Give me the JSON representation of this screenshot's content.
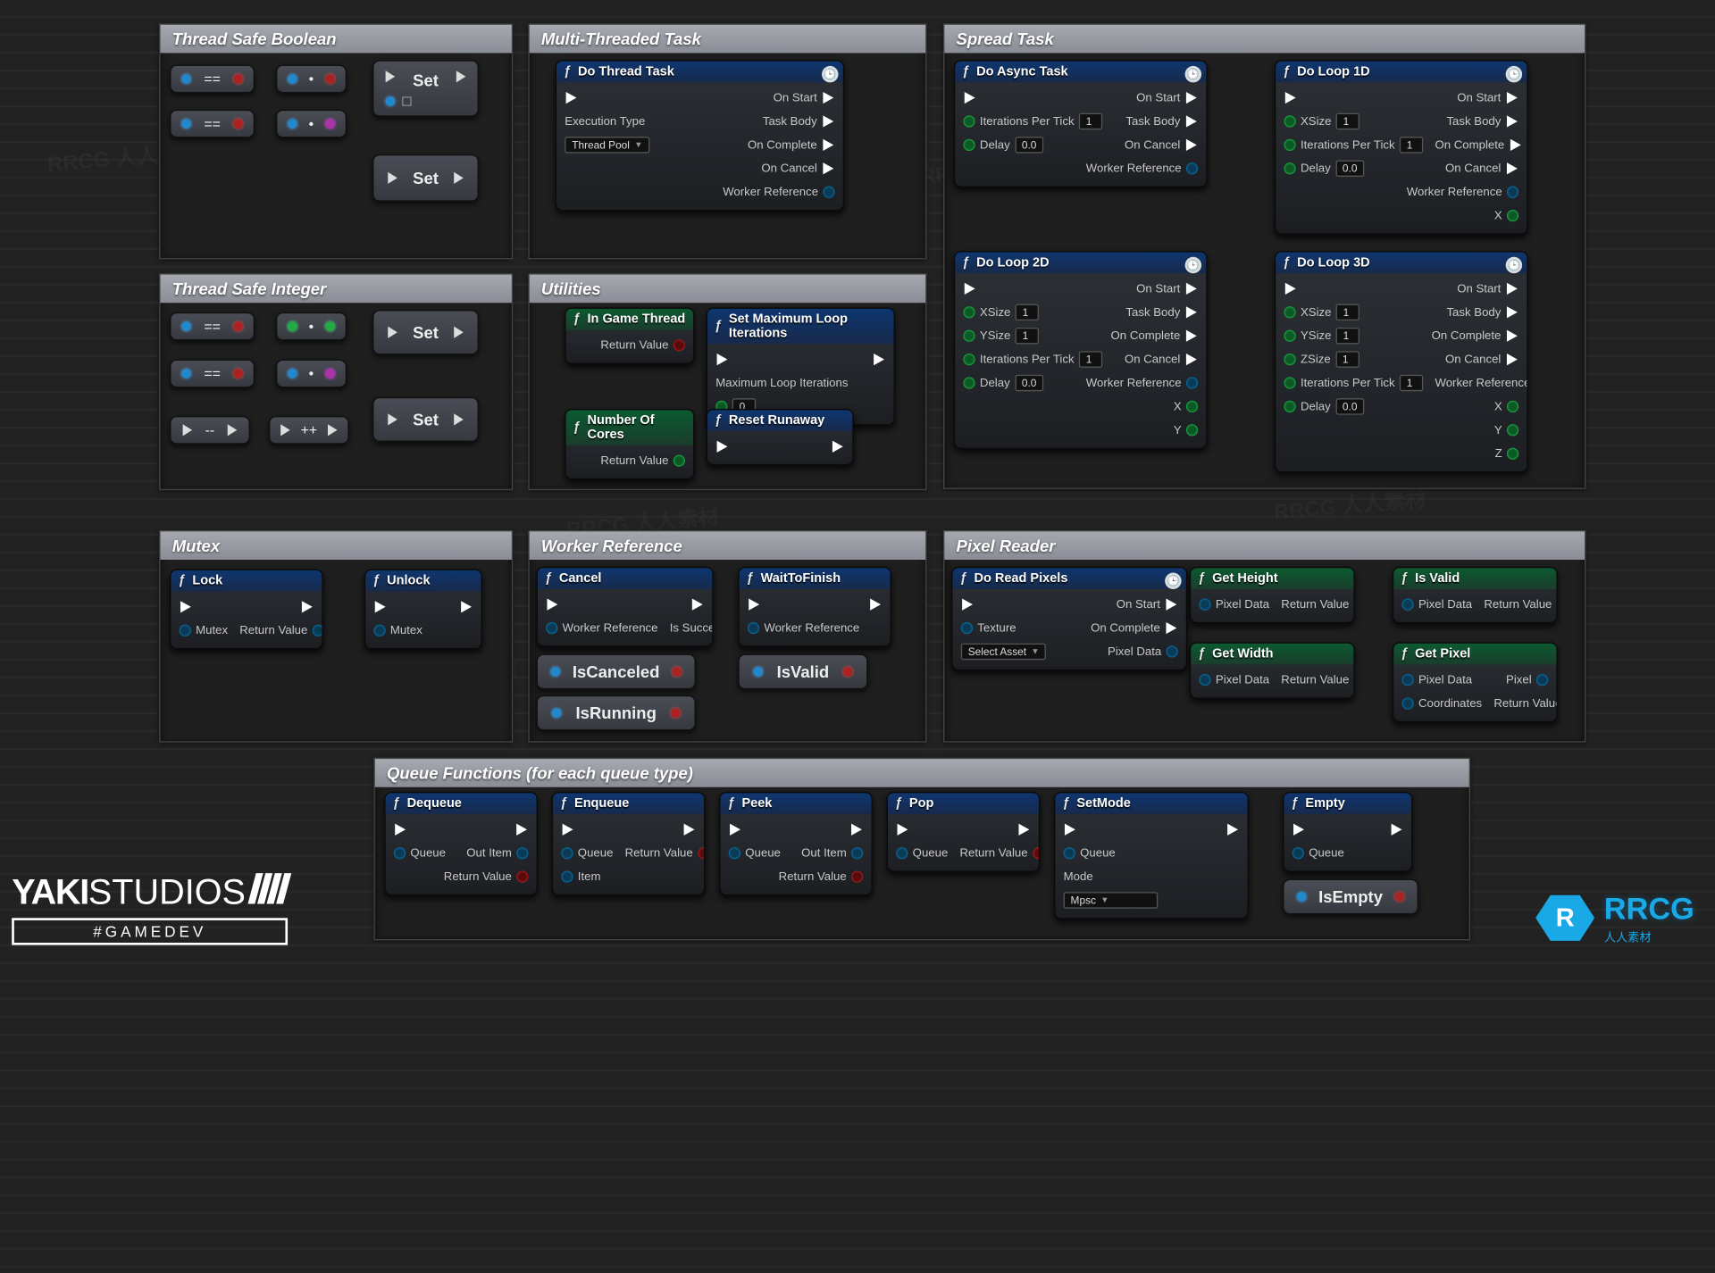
{
  "groups": {
    "tsb": "Thread Safe Boolean",
    "mt": "Multi-Threaded Task",
    "st": "Spread Task",
    "tsi": "Thread Safe Integer",
    "util": "Utilities",
    "mutex": "Mutex",
    "wr": "Worker Reference",
    "px": "Pixel Reader",
    "qf": "Queue Functions (for each queue type)"
  },
  "small": {
    "eq": "==",
    "dot": "•",
    "minusminus": "--",
    "plusplus": "++",
    "set": "Set"
  },
  "nodes": {
    "doThread": "Do Thread Task",
    "execType": "Execution Type",
    "execTypeVal": "Thread Pool",
    "onStart": "On Start",
    "taskBody": "Task Body",
    "onComplete": "On Complete",
    "onCancel": "On Cancel",
    "workerRef": "Worker Reference",
    "doAsync": "Do Async Task",
    "iterPerTick": "Iterations Per Tick",
    "delay": "Delay",
    "loop1d": "Do Loop 1D",
    "loop2d": "Do Loop 2D",
    "loop3d": "Do Loop 3D",
    "xsize": "XSize",
    "ysize": "YSize",
    "zsize": "ZSize",
    "x": "X",
    "y": "Y",
    "z": "Z",
    "val1": "1",
    "val0": "0",
    "val00": "0.0",
    "inGame": "In Game Thread",
    "numCores": "Number Of Cores",
    "returnValue": "Return Value",
    "setMaxLoop": "Set Maximum Loop Iterations",
    "maxLoopIt": "Maximum Loop Iterations",
    "resetRunaway": "Reset Runaway",
    "lock": "Lock",
    "unlock": "Unlock",
    "mutex": "Mutex",
    "cancel": "Cancel",
    "isSuccess": "Is Success",
    "waitFinish": "WaitToFinish",
    "isCanceled": "IsCanceled",
    "isValid": "IsValid",
    "isRunning": "IsRunning",
    "isEmpty": "IsEmpty",
    "doReadPixels": "Do Read Pixels",
    "texture": "Texture",
    "selectAsset": "Select Asset",
    "pixelData": "Pixel Data",
    "getHeight": "Get Height",
    "getWidth": "Get Width",
    "getPixel": "Get Pixel",
    "coords": "Coordinates",
    "pixel": "Pixel",
    "isValidN": "Is Valid",
    "dequeue": "Dequeue",
    "enqueue": "Enqueue",
    "peek": "Peek",
    "pop": "Pop",
    "setMode": "SetMode",
    "empty": "Empty",
    "queue": "Queue",
    "outItem": "Out Item",
    "item": "Item",
    "mode": "Mode",
    "modeVal": "Mpsc"
  },
  "brand": {
    "name1": "YAKI",
    "name2": "STUDIOS",
    "tag": "#GAMEDEV",
    "rcg": "RRCG",
    "sub": "人人素材"
  },
  "watermark": "RRCG 人人素材"
}
